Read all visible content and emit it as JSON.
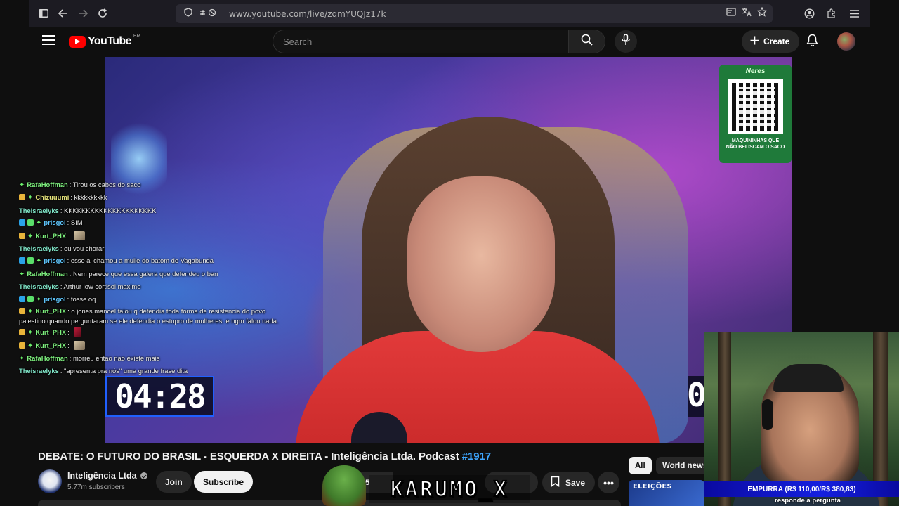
{
  "browser": {
    "url": "www.youtube.com/live/zqmYUQJz17k"
  },
  "header": {
    "logo_text": "YouTube",
    "country_code": "BR",
    "search_placeholder": "Search",
    "create_label": "Create"
  },
  "video": {
    "qr_brand": "Neres",
    "qr_caption_line1": "MAQUININHAS QUE",
    "qr_caption_line2": "NÃO BELISCAM O SACO",
    "timer": "04:28",
    "timer_partial": "0"
  },
  "chat": [
    {
      "user": "RafaHoffman",
      "badges": [
        "star"
      ],
      "color": "green",
      "message": "Tirou os cabos do saco"
    },
    {
      "user": "Chizuuumi",
      "badges": [
        "crown",
        "star"
      ],
      "color": "yellow",
      "message": "kkkkkkkkkk"
    },
    {
      "user": "Theisraelyks",
      "badges": [],
      "color": "teal",
      "message": "KKKKKKKKKKKKKKKKKKKKK"
    },
    {
      "user": "prisgol",
      "badges": [
        "blue",
        "green",
        "star"
      ],
      "color": "cyan",
      "message": "SIM"
    },
    {
      "user": "Kurt_PHX",
      "badges": [
        "crown",
        "star"
      ],
      "color": "green",
      "message": "",
      "emote": "emote"
    },
    {
      "user": "Theisraelyks",
      "badges": [],
      "color": "teal",
      "message": "eu vou chorar"
    },
    {
      "user": "prisgol",
      "badges": [
        "blue",
        "green",
        "star"
      ],
      "color": "cyan",
      "message": "esse ai chamou a mulie do batom de Vagabunda"
    },
    {
      "user": "RafaHoffman",
      "badges": [
        "star"
      ],
      "color": "green",
      "message": "Nem parece que essa galera que defendeu o ban"
    },
    {
      "user": "Theisraelyks",
      "badges": [],
      "color": "teal",
      "message": "Arthur low cortisol maximo"
    },
    {
      "user": "prisgol",
      "badges": [
        "blue",
        "green",
        "star"
      ],
      "color": "cyan",
      "message": "fosse oq"
    },
    {
      "user": "Kurt_PHX",
      "badges": [
        "crown",
        "star"
      ],
      "color": "green",
      "multi": true,
      "message": "o jones manoel falou q defendia toda forma de resistencia do povo palestino quando perguntaram se ele defendia o estupro de mulheres. e ngm falou nada."
    },
    {
      "user": "Kurt_PHX",
      "badges": [
        "crown",
        "star"
      ],
      "color": "green",
      "message": "",
      "emote": "emote red"
    },
    {
      "user": "Kurt_PHX",
      "badges": [
        "crown",
        "star"
      ],
      "color": "green",
      "message": "",
      "emote": "emote"
    },
    {
      "user": "RafaHoffman",
      "badges": [
        "star"
      ],
      "color": "green",
      "message": "morreu entao nao existe mais"
    },
    {
      "user": "Theisraelyks",
      "badges": [],
      "color": "teal",
      "message": "\"apresenta pra nós\" uma grande frase dita"
    }
  ],
  "watch": {
    "title_main": "DEBATE: O FUTURO DO BRASIL - ESQUERDA X DIREITA - Inteligência Ltda. Podcast",
    "title_hashtag": "#1917",
    "channel_name": "Inteligência Ltda",
    "subscribers": "5.77m subscribers",
    "join_label": "Join",
    "subscribe_label": "Subscribe",
    "like_count": "25",
    "save_label": "Save"
  },
  "sidebar": {
    "chips": [
      "All",
      "World news"
    ],
    "thumb_text": "ELEIÇÕES"
  },
  "overlay": {
    "streamer_name": "KARUMO_X",
    "bar_text": "EMPURRA (R$ 110,00/R$ 380,83)",
    "subtitle": "responde a pergunta"
  },
  "colors": {
    "accent_red": "#ff0000",
    "link_blue": "#3ea6ff",
    "background": "#0f0f0f"
  }
}
